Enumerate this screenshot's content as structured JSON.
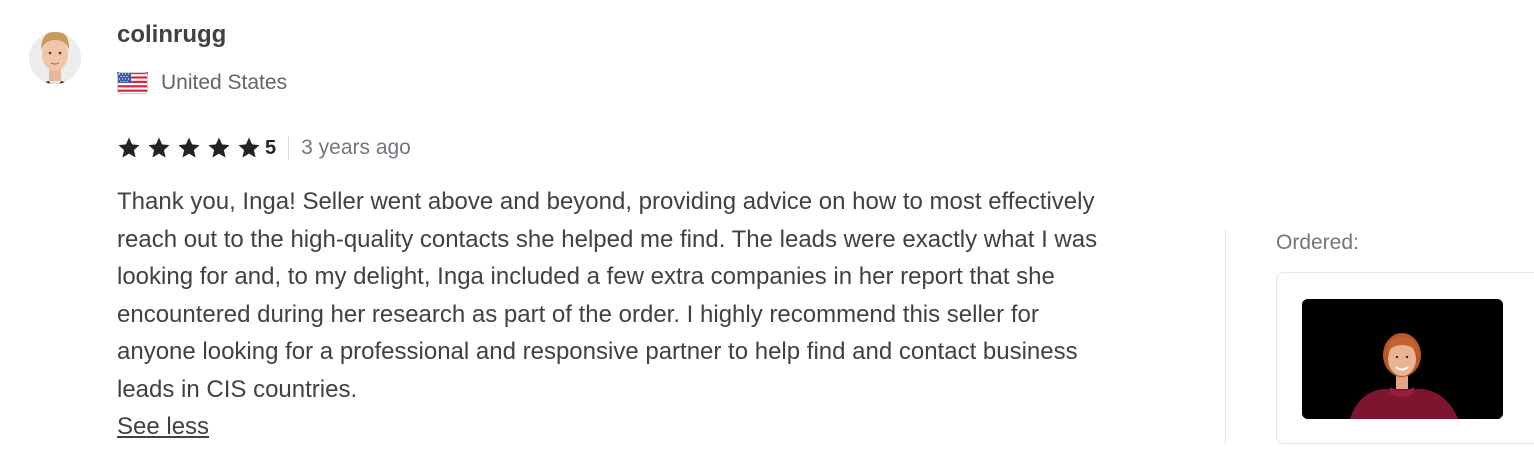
{
  "reviewer": {
    "username": "colinrugg",
    "country": "United States",
    "flag_icon": "us-flag-icon",
    "avatar_icon": "user-avatar"
  },
  "review": {
    "rating_value": "5",
    "stars": 5,
    "star_color": "#222325",
    "time_ago": "3 years ago",
    "text": "Thank you, Inga! Seller went above and beyond, providing advice on how to most effectively reach out to the high-quality contacts she helped me find. The leads were exactly what I was looking for and, to my delight, Inga included a few extra companies in her report that she encountered during her research as part of the order. I highly recommend this seller for anyone looking for a professional and responsive partner to help find and contact business leads in CIS countries.",
    "see_less_label": "See less"
  },
  "ordered": {
    "label": "Ordered:",
    "thumbnail_icon": "gig-thumbnail-image"
  }
}
